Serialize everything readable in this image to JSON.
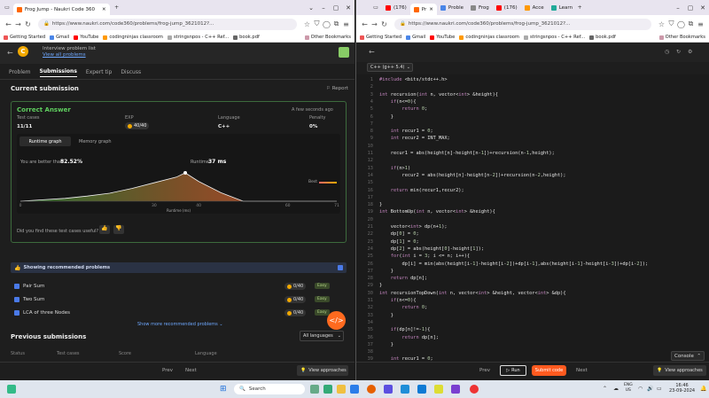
{
  "left_browser": {
    "tabs": [
      {
        "label": "Frog Jump - Naukri Code 360"
      }
    ],
    "url": "https://www.naukri.com/code360/problems/frog-jump_3621012?...",
    "bookmarks": [
      "Getting Started",
      "Gmail",
      "YouTube",
      "codingninjas classroom",
      "stringsnpos - C++ Ref...",
      "book.pdf"
    ],
    "other_bookmarks": "Other Bookmarks"
  },
  "right_browser": {
    "tabs": [
      {
        "label": "(176)"
      },
      {
        "label": "Pr"
      },
      {
        "label": "Proble"
      },
      {
        "label": "Frog"
      },
      {
        "label": "(176)"
      },
      {
        "label": "Acce"
      },
      {
        "label": "Learn"
      }
    ],
    "url": "https://www.naukri.com/code360/problems/frog-jump_3621012?...",
    "bookmarks": [
      "Getting Started",
      "Gmail",
      "YouTube",
      "codingninjas classroom",
      "stringsnpos - C++ Ref...",
      "book.pdf"
    ],
    "other_bookmarks": "Other Bookmarks"
  },
  "problem_header": {
    "crumb": "Interview problem list",
    "view_all": "View all problems"
  },
  "problem_tabs": [
    "Problem",
    "Submissions",
    "Expert tip",
    "Discuss"
  ],
  "current_submission": {
    "heading": "Current submission",
    "report": "Report",
    "verdict": "Correct Answer",
    "time_ago": "A few seconds ago",
    "labels": [
      "Test cases",
      "EXP",
      "Language",
      "Penalty"
    ],
    "values": {
      "test_cases": "11/11",
      "exp": "40/40",
      "language": "C++",
      "penalty": "0%"
    },
    "graph_tabs": [
      "Runtime graph",
      "Memory graph"
    ],
    "better_than_label": "You are better than",
    "better_than_value": "82.52%",
    "runtime_label": "Runtime",
    "runtime_value": "37 ms",
    "best_label": "Best",
    "axis_label": "Runtime (ms)",
    "feedback_q": "Did you find these test cases useful?"
  },
  "chart_data": {
    "type": "area",
    "x": [
      0,
      5,
      10,
      15,
      20,
      25,
      30,
      35,
      37,
      40,
      45,
      50,
      55,
      60,
      65,
      70,
      71
    ],
    "y": [
      0,
      0.05,
      0.1,
      0.18,
      0.28,
      0.45,
      0.65,
      0.85,
      1.0,
      0.7,
      0.3,
      0.0,
      0,
      0,
      0,
      0,
      0
    ],
    "xlabel": "Runtime (ms)",
    "xticks": [
      0,
      30,
      40,
      60,
      71
    ],
    "highlight_x": 37
  },
  "recommended": {
    "title": "Showing recommended problems",
    "items": [
      {
        "name": "Pair Sum",
        "exp": "0/40",
        "difficulty": "Easy"
      },
      {
        "name": "Two Sum",
        "exp": "0/40",
        "difficulty": "Easy"
      },
      {
        "name": "LCA of three Nodes",
        "exp": "0/40",
        "difficulty": "Easy"
      }
    ],
    "show_more": "Show more recommended problems"
  },
  "previous": {
    "heading": "Previous submissions",
    "filter": "All languages",
    "columns": [
      "Status",
      "Test cases",
      "Score",
      "Language"
    ]
  },
  "left_footer": {
    "prev": "Prev",
    "next": "Next",
    "view": "View approaches"
  },
  "editor": {
    "language": "C++ (g++ 5.4)",
    "lines": [
      "#include <bits/stdc++.h>",
      "",
      "int recursion(int n, vector<int> &height){",
      "    if(n<=0){",
      "        return 0;",
      "    }",
      "",
      "    int recur1 = 0;",
      "    int recur2 = INT_MAX;",
      "",
      "    recur1 = abs(height[n]-height[n-1])+recursion(n-1,height);",
      "",
      "    if(n>1)",
      "        recur2 = abs(height[n]-height[n-2])+recursion(n-2,height);",
      "",
      "    return min(recur1,recur2);",
      "",
      "}",
      "int BottomUp(int n, vector<int> &height){",
      "",
      "    vector<int> dp(n+1);",
      "    dp[0] = 0;",
      "    dp[1] = 0;",
      "    dp[2] = abs(height[0]-height[1]);",
      "    for(int i = 3; i <= n; i++){",
      "        dp[i] = min(abs(height[i-1]-height[i-2])+dp[i-1],abs(height[i-1]-height[i-3])+dp[i-2]);",
      "    }",
      "    return dp[n];",
      "}",
      "int recursionTopDown(int n, vector<int> &height, vector<int> &dp){",
      "    if(n<=0){",
      "        return 0;",
      "    }",
      "",
      "    if(dp[n]!=-1){",
      "        return dp[n];",
      "    }",
      "",
      "    int recur1 = 0;",
      "    int recur2 = INT_MAX;",
      ""
    ],
    "console": "Console",
    "prev": "Prev",
    "run": "Run",
    "submit": "Submit code",
    "next": "Next",
    "view": "View approaches"
  },
  "taskbar": {
    "search": "Search",
    "lang": "ENG",
    "region": "US",
    "time": "16:46",
    "date": "23-09-2024"
  }
}
